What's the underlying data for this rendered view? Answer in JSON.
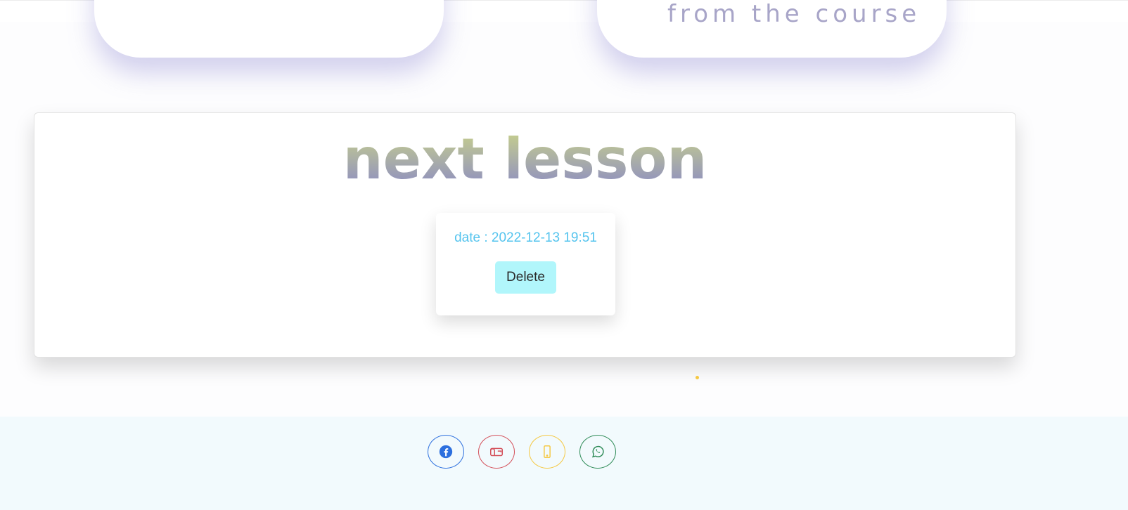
{
  "top_cards": {
    "right_partial_text": "from the course"
  },
  "lesson": {
    "title": "next lesson",
    "date": "date : 2022-12-13 19:51",
    "delete_label": "Delete"
  },
  "footer": {
    "socials": [
      {
        "icon": "facebook-icon",
        "color": "#2c6fde"
      },
      {
        "icon": "mailbox-icon",
        "color": "#d4505a"
      },
      {
        "icon": "phone-icon",
        "color": "#f5c842"
      },
      {
        "icon": "whatsapp-icon",
        "color": "#2e8b57"
      }
    ]
  },
  "colors": {
    "date_text": "#55c4ee",
    "delete_button": "#b1f6fb",
    "footer_bg": "#f2fafd"
  }
}
